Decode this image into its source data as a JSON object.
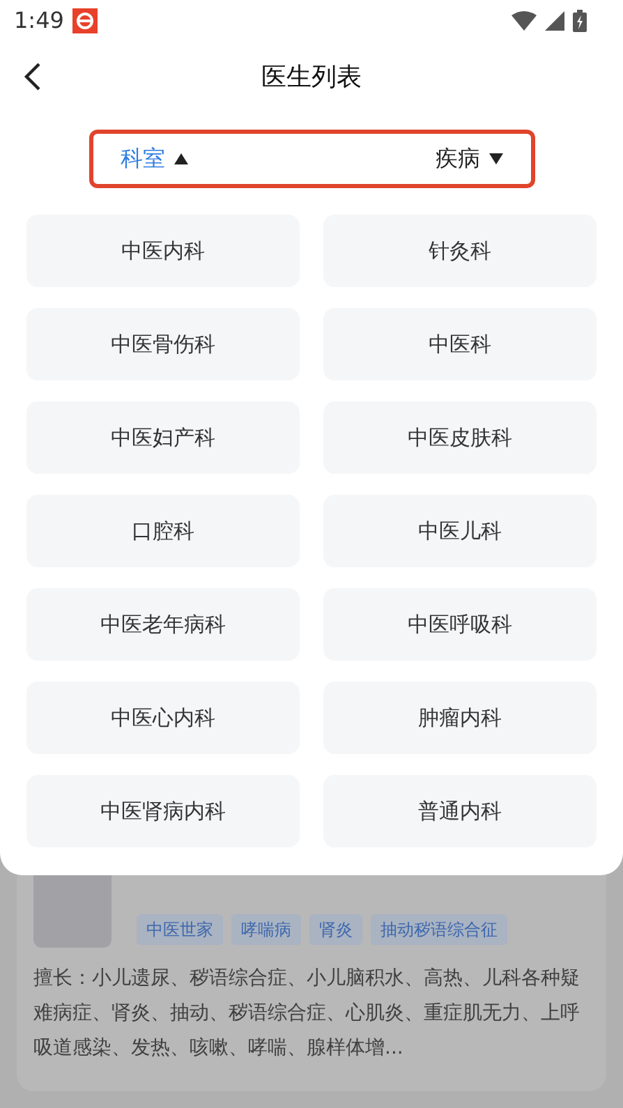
{
  "status_bar": {
    "time": "1:49"
  },
  "header": {
    "title": "医生列表"
  },
  "filters": [
    {
      "label": "科室",
      "selected": true
    },
    {
      "label": "疾病",
      "selected": false
    }
  ],
  "departments": [
    "中医内科",
    "针灸科",
    "中医骨伤科",
    "中医科",
    "中医妇产科",
    "中医皮肤科",
    "口腔科",
    "中医儿科",
    "中医老年病科",
    "中医呼吸科",
    "中医心内科",
    "肿瘤内科",
    "中医肾病内科",
    "普通内科"
  ],
  "doctor_card": {
    "tags": [
      "中医世家",
      "哮喘病",
      "肾炎",
      "抽动秽语综合征"
    ],
    "specialty": "擅长：小儿遗尿、秽语综合症、小儿脑积水、高热、儿科各种疑难病症、肾炎、抽动、秽语综合症、心肌炎、重症肌无力、上呼吸道感染、发热、咳嗽、哮喘、腺样体增..."
  }
}
